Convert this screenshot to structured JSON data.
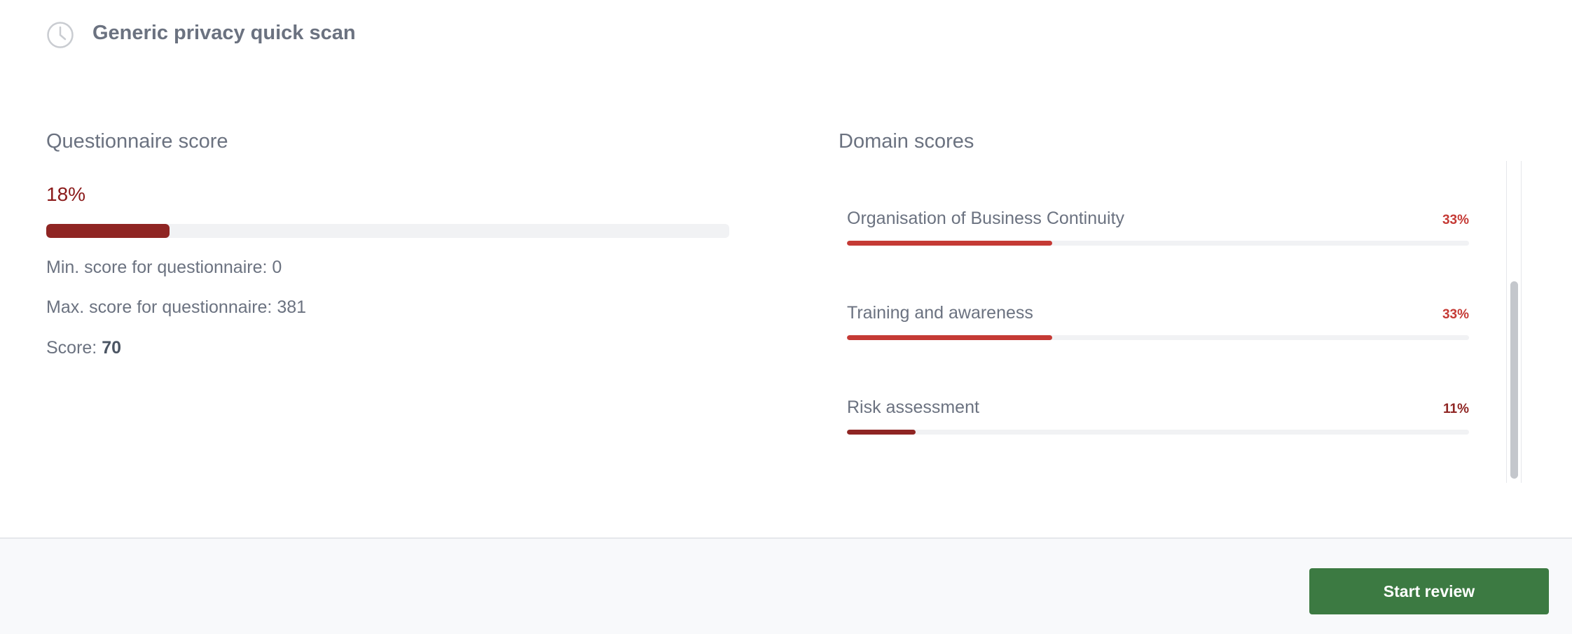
{
  "header": {
    "title": "Generic privacy quick scan",
    "icon": "clock-icon"
  },
  "questionnaire": {
    "title": "Questionnaire score",
    "percent_label": "18%",
    "progress": 0.18,
    "bar_color": "#8f2523",
    "min_label": "Min. score for questionnaire: 0",
    "max_label": "Max. score for questionnaire: 381",
    "score_label": "Score: ",
    "score_value": "70"
  },
  "domain": {
    "title": "Domain scores",
    "items": [
      {
        "label": "Organisation of Business Continuity",
        "percent_label": "33%",
        "progress": 0.33,
        "color": "#c53a35"
      },
      {
        "label": "Training and awareness",
        "percent_label": "33%",
        "progress": 0.33,
        "color": "#c53a35"
      },
      {
        "label": "Risk assessment",
        "percent_label": "11%",
        "progress": 0.11,
        "color": "#8f2523"
      }
    ]
  },
  "footer": {
    "start_review_label": "Start review",
    "button_color": "#3c7a42"
  }
}
